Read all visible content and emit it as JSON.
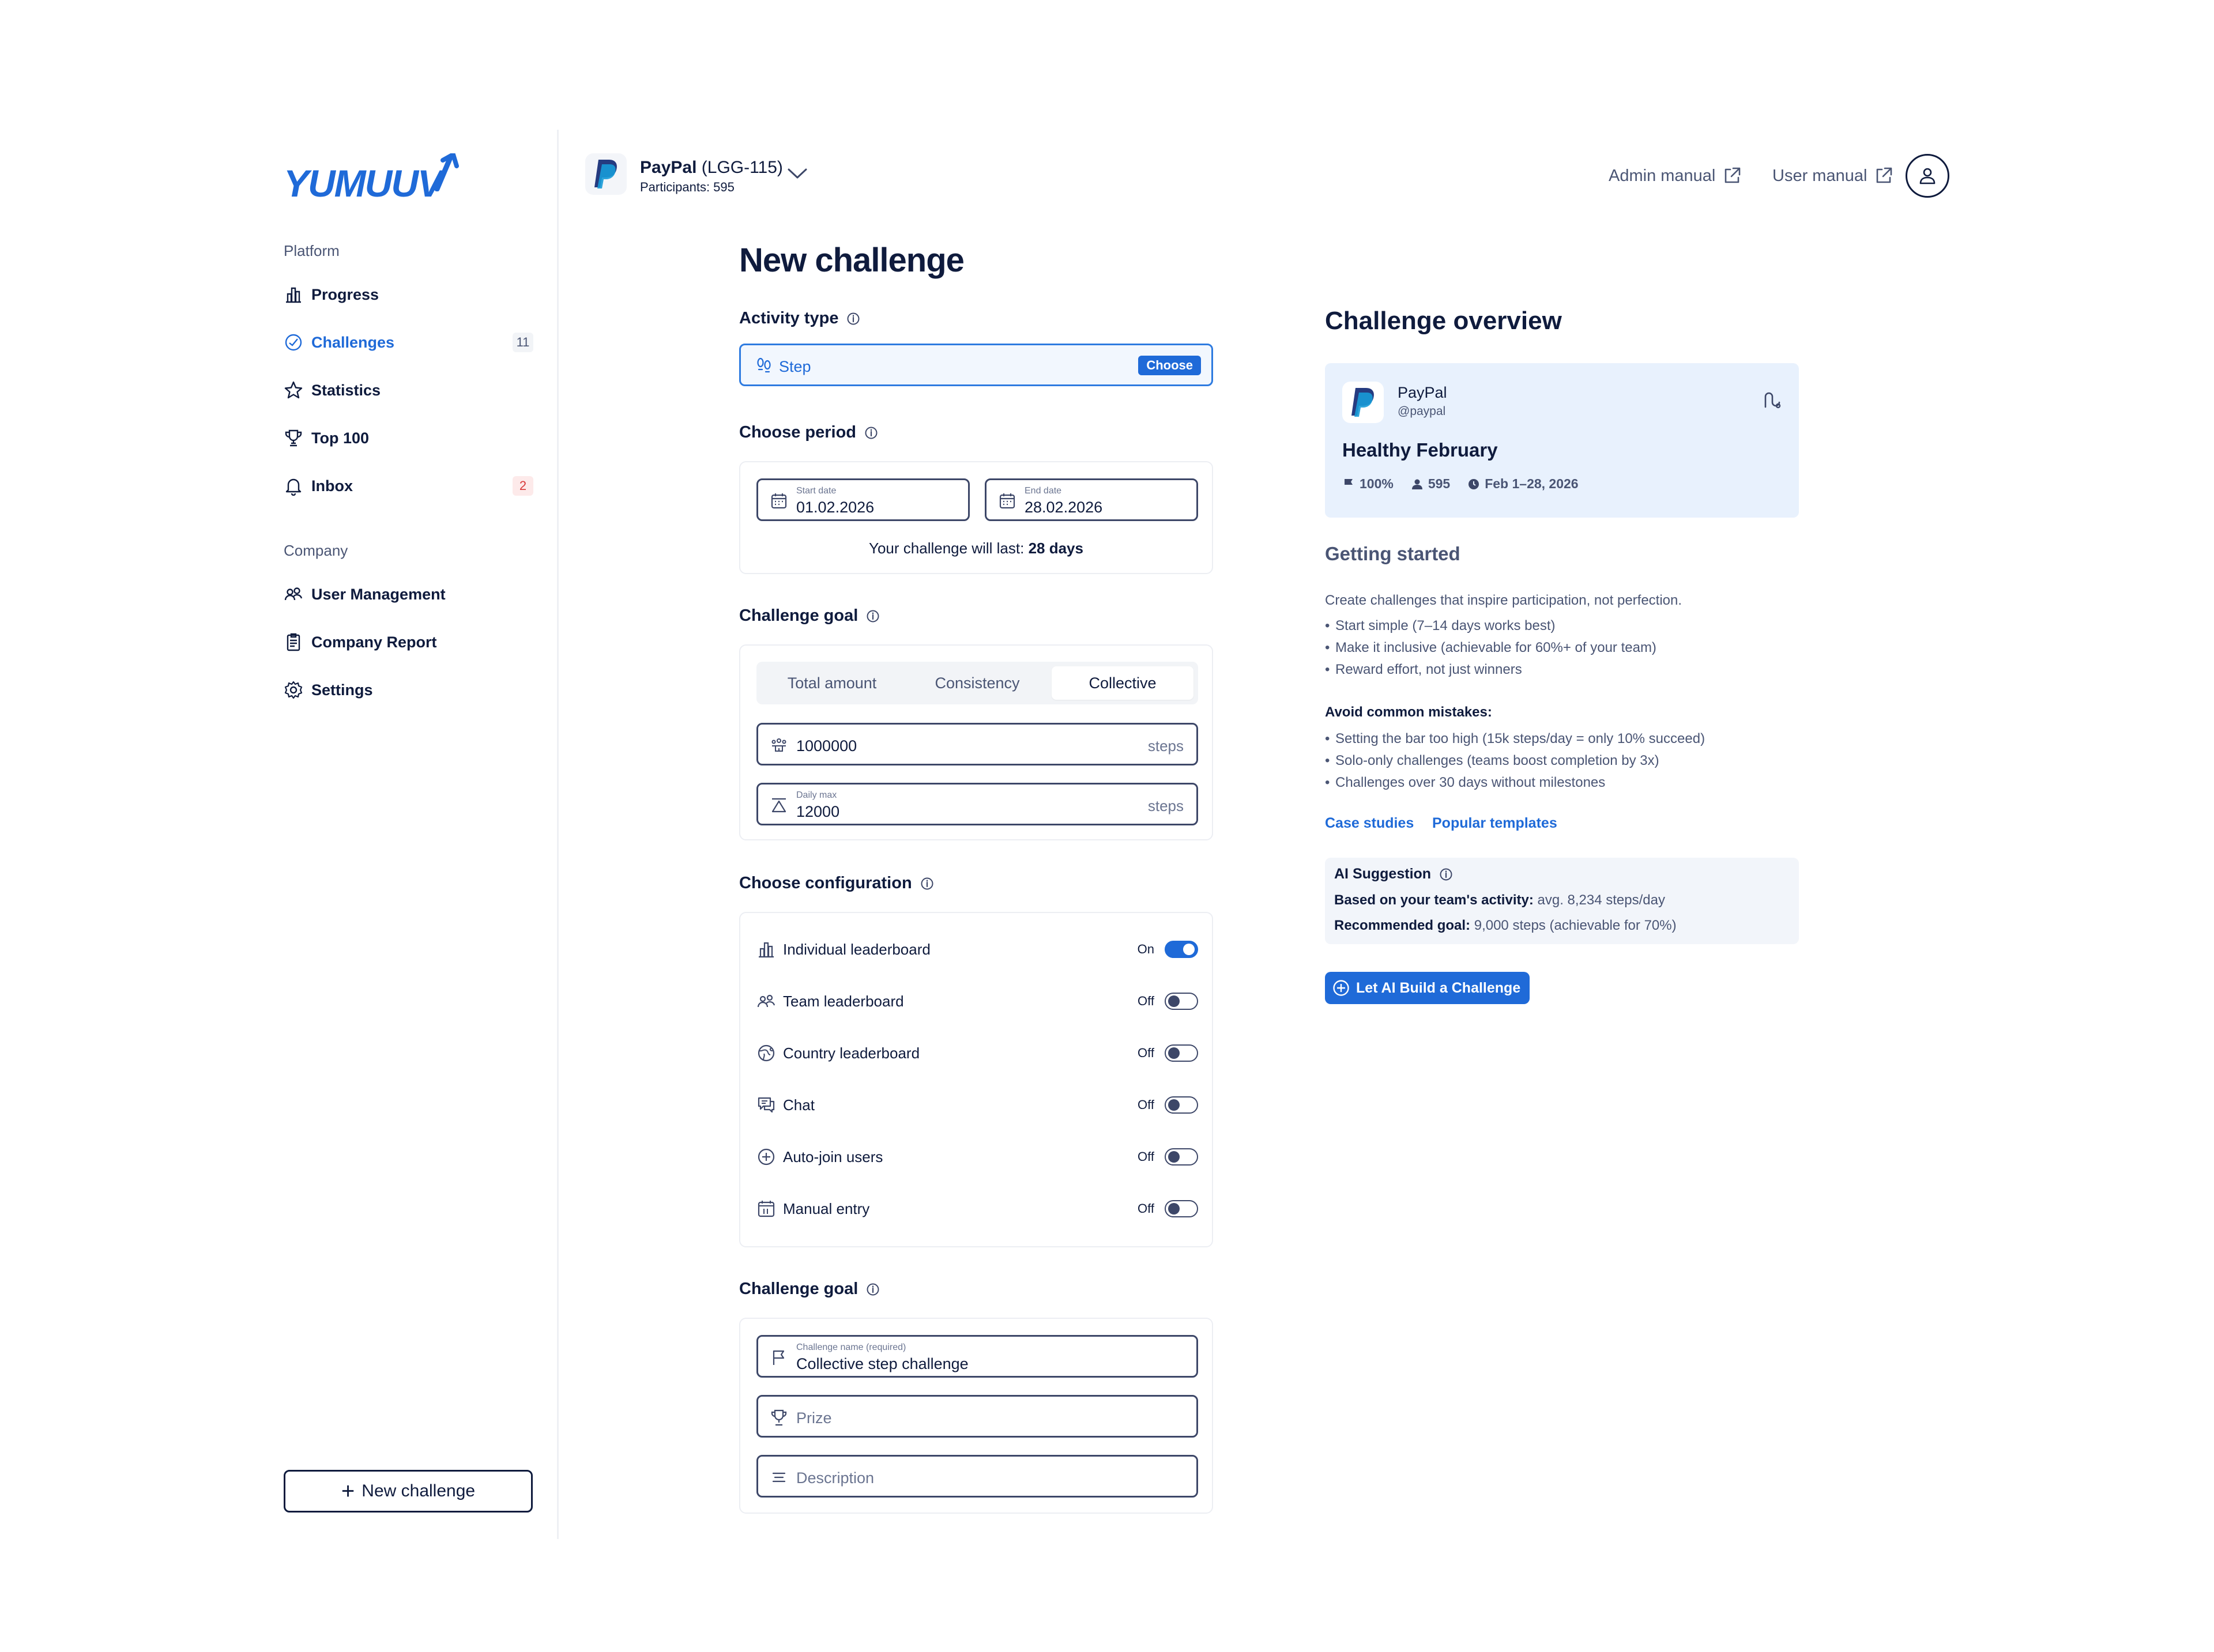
{
  "brand": {
    "logo_text": "YUMUUV",
    "accent": "#1f6ad8"
  },
  "sidebar": {
    "platform_label": "Platform",
    "company_label": "Company",
    "platform_items": [
      {
        "label": "Progress",
        "icon": "bar-chart-icon"
      },
      {
        "label": "Challenges",
        "icon": "challenge-icon",
        "badge": "11",
        "active": true
      },
      {
        "label": "Statistics",
        "icon": "star-icon"
      },
      {
        "label": "Top 100",
        "icon": "trophy-icon"
      },
      {
        "label": "Inbox",
        "icon": "bell-icon",
        "badge": "2"
      }
    ],
    "company_items": [
      {
        "label": "User Management",
        "icon": "users-icon"
      },
      {
        "label": "Company Report",
        "icon": "clipboard-icon"
      },
      {
        "label": "Settings",
        "icon": "gear-icon"
      }
    ],
    "new_challenge_label": "New challenge"
  },
  "header": {
    "org_name": "PayPal",
    "org_code": "(LGG-115)",
    "participants": "Participants: 595",
    "admin_manual": "Admin manual",
    "user_manual": "User manual"
  },
  "form": {
    "page_title": "New challenge",
    "activity_type": {
      "title": "Activity type",
      "value": "Step",
      "choose_label": "Choose"
    },
    "period": {
      "title": "Choose period",
      "start_label": "Start date",
      "start_value": "01.02.2026",
      "end_label": "End date",
      "end_value": "28.02.2026",
      "duration_prefix": "Your challenge will last:",
      "duration_value": "28 days"
    },
    "goal": {
      "title": "Challenge goal",
      "tabs": [
        "Total amount",
        "Consistency",
        "Collective"
      ],
      "active_tab": "Collective",
      "amount_value": "1000000",
      "amount_unit": "steps",
      "daily_max_label": "Daily max",
      "daily_max_value": "12000",
      "daily_max_unit": "steps"
    },
    "configuration": {
      "title": "Choose configuration",
      "items": [
        {
          "label": "Individual leaderboard",
          "icon": "bar-chart-icon",
          "state": "On",
          "on": true
        },
        {
          "label": "Team leaderboard",
          "icon": "team-icon",
          "state": "Off",
          "on": false
        },
        {
          "label": "Country leaderboard",
          "icon": "globe-icon",
          "state": "Off",
          "on": false
        },
        {
          "label": "Chat",
          "icon": "chat-icon",
          "state": "Off",
          "on": false
        },
        {
          "label": "Auto-join users",
          "icon": "plus-circle-icon",
          "state": "Off",
          "on": false
        },
        {
          "label": "Manual entry",
          "icon": "calendar-icon",
          "state": "Off",
          "on": false
        }
      ]
    },
    "details": {
      "title": "Challenge goal",
      "name_label": "Challenge name (required)",
      "name_value": "Collective step challenge",
      "prize_placeholder": "Prize",
      "description_placeholder": "Description"
    }
  },
  "overview": {
    "title": "Challenge overview",
    "org_name": "PayPal",
    "org_handle": "@paypal",
    "challenge_name": "Healthy February",
    "completion": "100%",
    "participants": "595",
    "dates": "Feb 1–28, 2026",
    "getting_started": {
      "title": "Getting started",
      "intro": "Create challenges that inspire participation, not perfection.",
      "tips": [
        "Start simple (7–14 days works best)",
        "Make it inclusive (achievable for 60%+ of your team)",
        "Reward effort, not just winners"
      ],
      "mistakes_title": "Avoid common mistakes:",
      "mistakes": [
        "Setting the bar too high (15k steps/day = only 10% succeed)",
        "Solo-only challenges (teams boost completion by 3x)",
        "Challenges over 30 days without milestones"
      ],
      "links": [
        "Case studies",
        "Popular templates"
      ]
    },
    "ai": {
      "title": "AI Suggestion",
      "activity_label": "Based on your team's activity:",
      "activity_value": "avg. 8,234 steps/day",
      "goal_label": "Recommended goal:",
      "goal_value": "9,000 steps (achievable for 70%)",
      "button_label": "Let AI Build a Challenge"
    }
  }
}
